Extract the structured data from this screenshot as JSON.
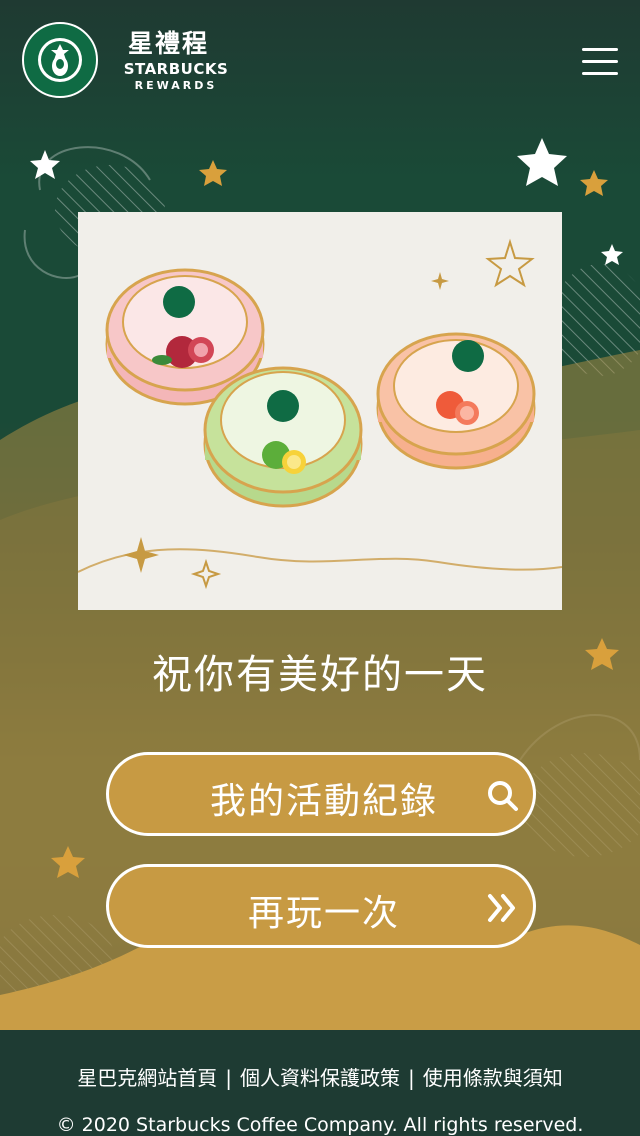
{
  "header": {
    "brand_zh": "星禮程",
    "brand_en": "STARBUCKS",
    "brand_sub": "REWARDS",
    "menu_icon": "hamburger-menu-icon"
  },
  "main": {
    "greeting": "祝你有美好的一天",
    "buttons": [
      {
        "label": "我的活動紀錄",
        "icon": "search-icon"
      },
      {
        "label": "再玩一次",
        "icon": "double-chevron-right-icon"
      }
    ]
  },
  "footer": {
    "links": [
      {
        "label": "星巴克網站首頁"
      },
      {
        "label": "個人資料保護政策"
      },
      {
        "label": "使用條款與須知"
      }
    ],
    "copyright": "© 2020 Starbucks Coffee Company. All rights reserved."
  },
  "colors": {
    "dark_green": "#1e3b33",
    "brand_green": "#0f6b44",
    "gold": "#c79a43",
    "white": "#ffffff"
  }
}
